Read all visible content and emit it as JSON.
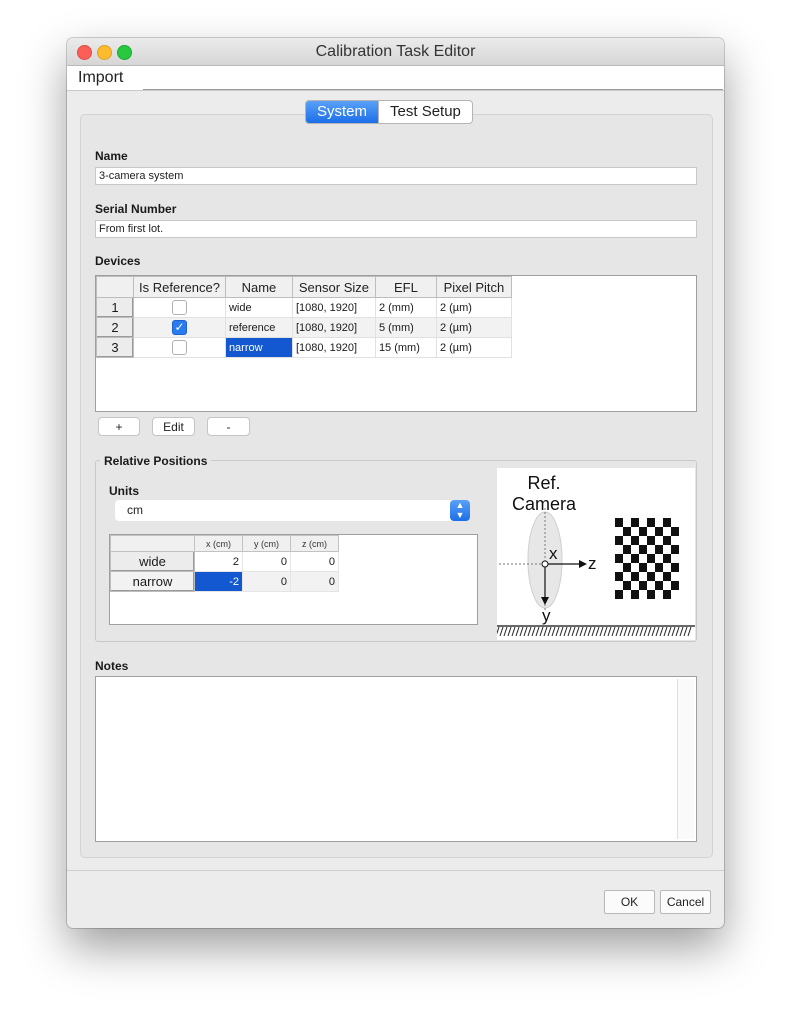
{
  "window": {
    "title": "Calibration Task Editor"
  },
  "menu": {
    "import": "Import"
  },
  "tabs": [
    {
      "label": "System",
      "active": true
    },
    {
      "label": "Test Setup",
      "active": false
    }
  ],
  "system": {
    "name_label": "Name",
    "name_value": "3-camera system",
    "serial_label": "Serial Number",
    "serial_value": "From first lot.",
    "devices_label": "Devices",
    "devices": {
      "columns": [
        "Is Reference?",
        "Name",
        "Sensor Size",
        "EFL",
        "Pixel Pitch"
      ],
      "rows": [
        {
          "index": "1",
          "is_reference": false,
          "name": "wide",
          "sensor_size": "[1080, 1920]",
          "efl": "2 (mm)",
          "pixel_pitch": "2 (µm)"
        },
        {
          "index": "2",
          "is_reference": true,
          "name": "reference",
          "sensor_size": "[1080, 1920]",
          "efl": "5 (mm)",
          "pixel_pitch": "2 (µm)"
        },
        {
          "index": "3",
          "is_reference": false,
          "name": "narrow",
          "sensor_size": "[1080, 1920]",
          "efl": "15 (mm)",
          "pixel_pitch": "2 (µm)"
        }
      ]
    },
    "buttons": {
      "add": "+",
      "edit": "Edit",
      "remove": "-"
    },
    "relative_positions": {
      "group_label": "Relative Positions",
      "units_label": "Units",
      "units_value": "cm",
      "columns": [
        "x (cm)",
        "y (cm)",
        "z (cm)"
      ],
      "rows": [
        {
          "name": "wide",
          "x": "2",
          "y": "0",
          "z": "0"
        },
        {
          "name": "narrow",
          "x": "-2",
          "y": "0",
          "z": "0"
        }
      ],
      "diagram": {
        "line1": "Ref.",
        "line2": "Camera",
        "axis_x": "x",
        "axis_y": "y",
        "axis_z": "z"
      }
    },
    "notes_label": "Notes",
    "notes_value": ""
  },
  "dialog": {
    "ok": "OK",
    "cancel": "Cancel"
  },
  "colors": {
    "accent": "#1b6fe8",
    "selection": "#1358d0",
    "close": "#fc5f57",
    "minimize": "#fdbc2e",
    "maximize": "#28c840"
  }
}
